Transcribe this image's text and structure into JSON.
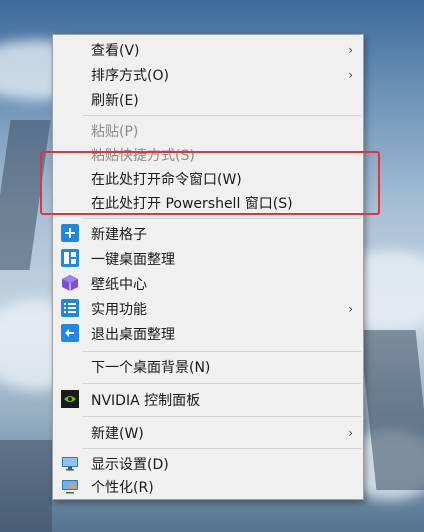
{
  "menu": {
    "view": "查看(V)",
    "sort": "排序方式(O)",
    "refresh": "刷新(E)",
    "paste": "粘贴(P)",
    "paste_shortcut": "粘贴快捷方式(S)",
    "open_cmd": "在此处打开命令窗口(W)",
    "open_powershell": "在此处打开 Powershell 窗口(S)",
    "new_grid": "新建格子",
    "one_click_organize": "一键桌面整理",
    "wallpaper_center": "壁纸中心",
    "utilities": "实用功能",
    "exit_organize": "退出桌面整理",
    "next_background": "下一个桌面背景(N)",
    "nvidia_panel": "NVIDIA 控制面板",
    "new": "新建(W)",
    "display_settings": "显示设置(D)",
    "personalize": "个性化(R)",
    "submenu_arrow": "›"
  },
  "colors": {
    "menu_bg": "#f0f0f0",
    "accent_blue": "#1e88e5",
    "wallpaper_purple": "#7b4fd6",
    "highlight_red": "#e8313b",
    "nvidia_green": "#76b900"
  },
  "icons": [
    "plus-icon",
    "layout-icon",
    "cube-icon",
    "list-icon",
    "exit-icon",
    "nvidia-icon",
    "display-icon",
    "personalize-icon"
  ]
}
